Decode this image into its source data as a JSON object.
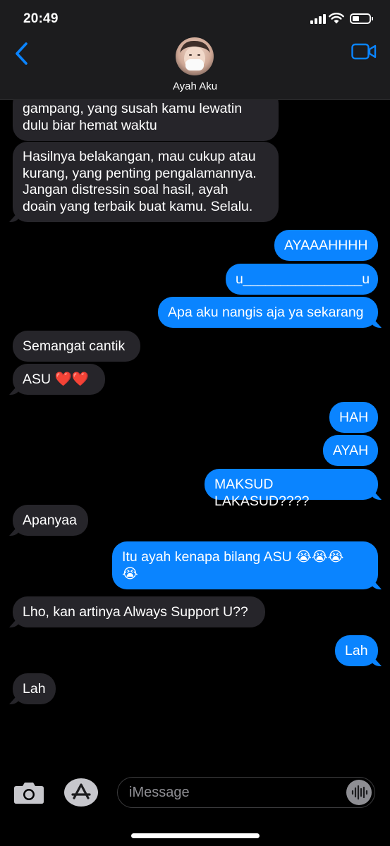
{
  "status_bar": {
    "time": "20:49"
  },
  "header": {
    "contact_name": "Ayah Aku",
    "back_icon": "chevron-left-icon",
    "video_icon": "video-camera-icon"
  },
  "messages": [
    {
      "from": "received",
      "text": "gampang, yang susah kamu lewatin\ndulu biar hemat waktu"
    },
    {
      "from": "received",
      "text": "Hasilnya belakangan, mau cukup atau\nkurang, yang penting pengalamannya.\nJangan distressin soal hasil, ayah\ndoain yang terbaik buat kamu. Selalu."
    },
    {
      "from": "sent",
      "text": "AYAAAHHHH"
    },
    {
      "from": "sent",
      "text": "u________________u"
    },
    {
      "from": "sent",
      "text": "Apa aku nangis aja ya sekarang"
    },
    {
      "from": "received",
      "text": "Semangat cantik"
    },
    {
      "from": "received",
      "text": "ASU ❤️❤️"
    },
    {
      "from": "sent",
      "text": "HAH"
    },
    {
      "from": "sent",
      "text": "AYAH"
    },
    {
      "from": "sent",
      "text": "MAKSUD LAKASUD????"
    },
    {
      "from": "received",
      "text": "Apanyaa"
    },
    {
      "from": "sent",
      "text": "Itu ayah kenapa bilang ASU 😭😭😭\n😭"
    },
    {
      "from": "received",
      "text": "Lho, kan artinya Always Support U??"
    },
    {
      "from": "sent",
      "text": "Lah"
    },
    {
      "from": "received",
      "text": "Lah"
    }
  ],
  "input_bar": {
    "placeholder": "iMessage",
    "camera_icon": "camera-icon",
    "apps_icon": "app-store-icon",
    "audio_icon": "audio-waveform-icon"
  },
  "colors": {
    "sent": "#0a84ff",
    "received": "#26252a",
    "background": "#000000",
    "header": "#1c1c1e"
  }
}
